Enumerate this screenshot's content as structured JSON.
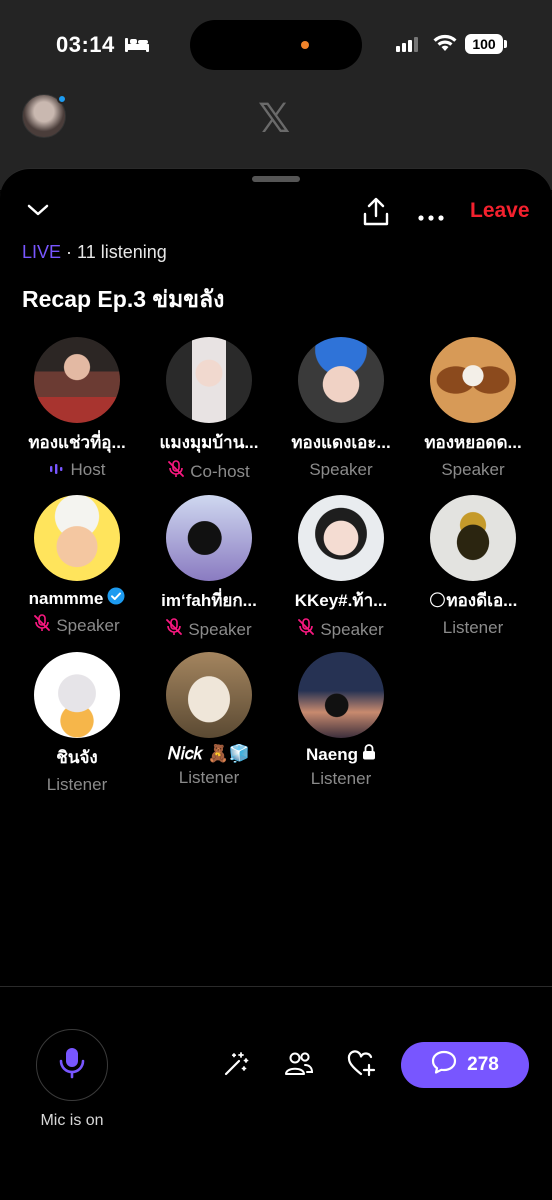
{
  "status_bar": {
    "time": "03:14",
    "battery": "100"
  },
  "space": {
    "live_label": "LIVE",
    "listening": "· 11 listening",
    "title": "Recap Ep.3 ข่มขลัง",
    "leave_label": "Leave",
    "accent_color": "#7856ff",
    "leave_color": "#f4212e"
  },
  "participants": [
    {
      "name": "ทองแช่วที่อุ...",
      "role": "Host",
      "role_icon": "host-audio-icon"
    },
    {
      "name": "แมงมุมบ้าน...",
      "role": "Co-host",
      "role_icon": "mic-off-icon"
    },
    {
      "name": "ทองแดงเอะ...",
      "role": "Speaker",
      "role_icon": ""
    },
    {
      "name": "ทองหยอดด...",
      "role": "Speaker",
      "role_icon": ""
    },
    {
      "name": "nammme",
      "role": "Speaker",
      "role_icon": "mic-off-icon",
      "badge": "verified-icon"
    },
    {
      "name": "im‘fahที่ยก...",
      "role": "Speaker",
      "role_icon": "mic-off-icon"
    },
    {
      "name": "KKey#.ท้า...",
      "role": "Speaker",
      "role_icon": "mic-off-icon"
    },
    {
      "name": "🌕ทองดีเอ...",
      "role": "Listener",
      "role_icon": ""
    },
    {
      "name": "ชินจัง",
      "role": "Listener",
      "role_icon": ""
    },
    {
      "name": "𝑁𝑖𝑐𝑘 🧸🧊",
      "role": "Listener",
      "role_icon": ""
    },
    {
      "name": "Naeng",
      "role": "Listener",
      "role_icon": "",
      "badge": "lock-icon"
    }
  ],
  "bottom": {
    "mic_label": "Mic is on",
    "comment_count": "278"
  }
}
